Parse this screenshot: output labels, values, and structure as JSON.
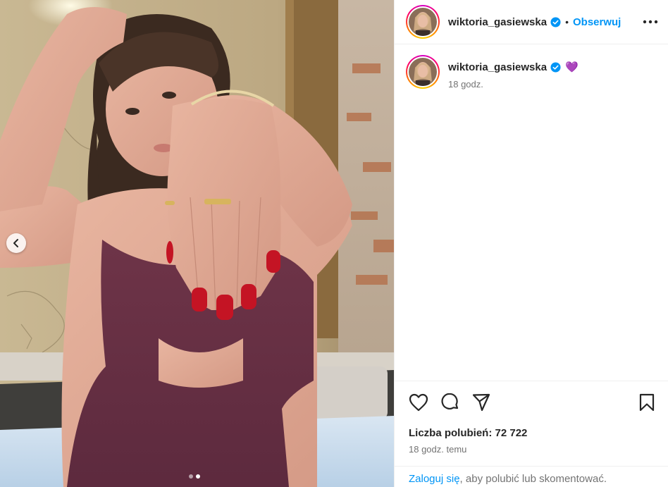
{
  "post": {
    "username": "wiktoria_gasiewska",
    "follow_label": "Obserwuj",
    "separator": "•",
    "caption_emoji": "💜",
    "caption_time": "18 godz.",
    "likes_text": "Liczba polubień: 72 722",
    "time_ago": "18 godz. temu",
    "login_link": "Zaloguj się",
    "login_rest": ", aby polubić lub skomentować.",
    "carousel": {
      "slides": 2,
      "active_slide": 2
    }
  },
  "colors": {
    "accent": "#0095f6",
    "verified": "#0095f6",
    "text": "#262626",
    "muted": "#737373"
  },
  "icons": {
    "verified": "verified-badge-icon",
    "more": "more-options-icon",
    "like": "heart-icon",
    "comment": "comment-icon",
    "share": "share-icon",
    "save": "bookmark-icon",
    "prev": "chevron-left-icon"
  }
}
